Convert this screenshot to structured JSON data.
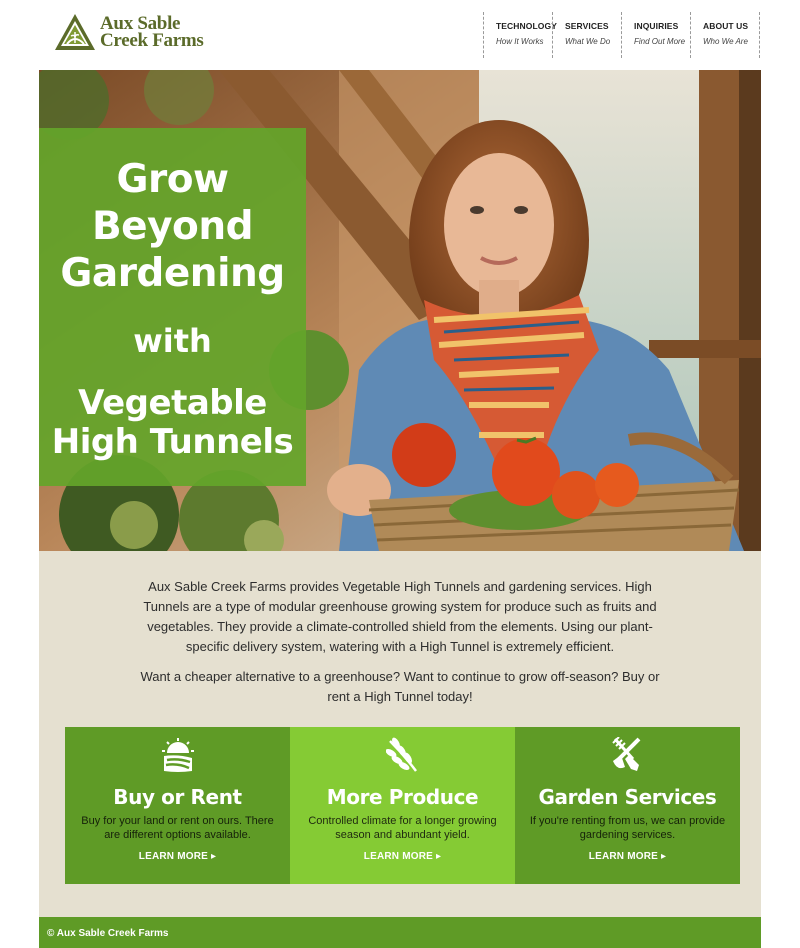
{
  "brand": {
    "line1": "Aux Sable",
    "line2": "Creek Farms",
    "logo_icon": "triangle-farm-logo",
    "color": "#5b6b2a"
  },
  "nav": [
    {
      "title": "TECHNOLOGY",
      "sub": "How It Works"
    },
    {
      "title": "SERVICES",
      "sub": "What We Do"
    },
    {
      "title": "INQUIRIES",
      "sub": "Find Out More"
    },
    {
      "title": "ABOUT US",
      "sub": "Who We Are"
    }
  ],
  "hero": {
    "line1": "Grow",
    "line2": "Beyond",
    "line3": "Gardening",
    "line4": "with",
    "line5": "Vegetable",
    "line6": "High Tunnels",
    "overlay_color": "#64a52a"
  },
  "intro": {
    "p1": "Aux Sable Creek Farms provides Vegetable High Tunnels and gardening services. High Tunnels are a type of modular greenhouse growing system for produce such as fruits and vegetables. They provide a climate-controlled shield from the elements. Using our plant-specific delivery system, watering with a High Tunnel is extremely efficient.",
    "p2": "Want a cheaper alternative to a greenhouse? Want to continue to grow off-season? Buy or rent a High Tunnel today!"
  },
  "cards": [
    {
      "icon": "sunrise-field-icon",
      "title": "Buy or Rent",
      "desc": "Buy for your land or rent on ours. There are different options available.",
      "more": "LEARN MORE ▸"
    },
    {
      "icon": "wheat-sprout-icon",
      "title": "More Produce",
      "desc": "Controlled climate for a longer growing season and abundant yield.",
      "more": "LEARN MORE ▸"
    },
    {
      "icon": "garden-tools-icon",
      "title": "Garden Services",
      "desc": "If you're renting from us, we can provide gardening services.",
      "more": "LEARN MORE ▸"
    }
  ],
  "colors": {
    "dark_green": "#5f9b26",
    "light_green": "#85cb34",
    "beige": "#e5e0d0"
  },
  "footer": {
    "copyright": "© Aux Sable Creek Farms"
  }
}
